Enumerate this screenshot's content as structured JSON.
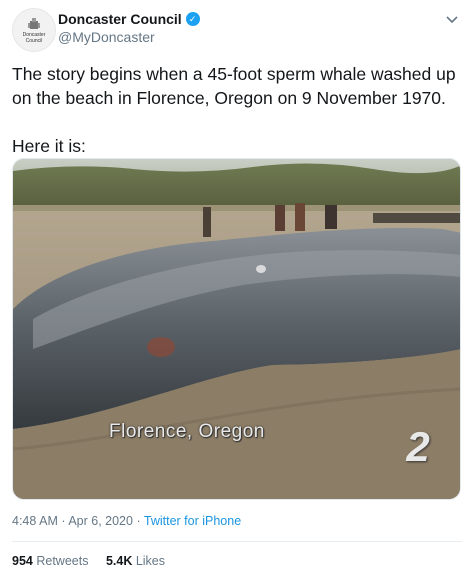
{
  "author": {
    "display_name": "Doncaster Council",
    "handle": "@MyDoncaster",
    "avatar_text_line1": "Doncaster",
    "avatar_text_line2": "Council",
    "verified": true
  },
  "tweet": {
    "paragraph1": "The story begins when a 45-foot sperm whale washed up on the beach in Florence, Oregon on 9 November 1970.",
    "paragraph2": "Here it is:"
  },
  "media": {
    "caption": "Florence, Oregon",
    "channel_logo": "2"
  },
  "meta": {
    "time": "4:48 AM",
    "separator": "·",
    "date": "Apr 6, 2020",
    "source": "Twitter for iPhone"
  },
  "stats": {
    "retweets_count": "954",
    "retweets_label": "Retweets",
    "likes_count": "5.4K",
    "likes_label": "Likes"
  },
  "colors": {
    "link": "#1b95e0",
    "verified": "#1da1f2",
    "muted": "#657786"
  }
}
